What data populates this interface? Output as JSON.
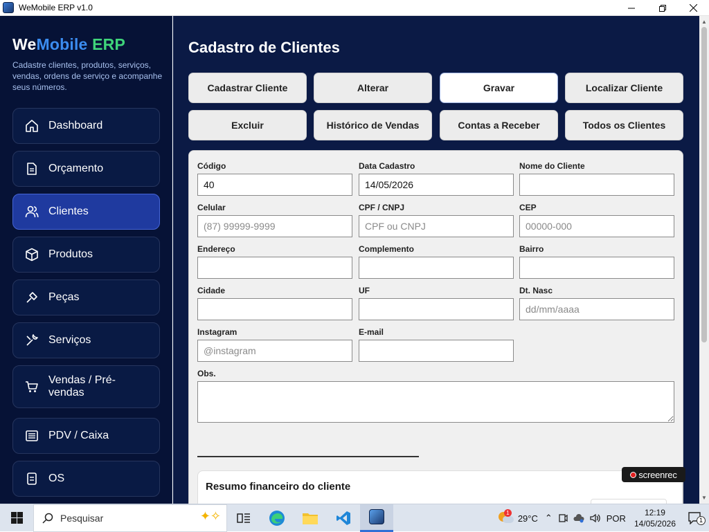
{
  "window": {
    "title": "WeMobile ERP v1.0"
  },
  "brand": {
    "part1": "We",
    "part2": "Mobile",
    "part3": "ERP",
    "description": "Cadastre clientes, produtos, serviços, vendas, ordens de serviço e acompanhe seus números."
  },
  "sidebar": {
    "items": [
      {
        "label": "Dashboard",
        "icon": "home-icon"
      },
      {
        "label": "Orçamento",
        "icon": "document-icon"
      },
      {
        "label": "Clientes",
        "icon": "users-icon",
        "active": true
      },
      {
        "label": "Produtos",
        "icon": "box-icon"
      },
      {
        "label": "Peças",
        "icon": "tool-icon"
      },
      {
        "label": "Serviços",
        "icon": "wrench-icon"
      },
      {
        "label": "Vendas / Pré-vendas",
        "icon": "cart-icon"
      },
      {
        "label": "PDV / Caixa",
        "icon": "register-icon"
      },
      {
        "label": "OS",
        "icon": "clipboard-icon"
      }
    ]
  },
  "main": {
    "title": "Cadastro de Clientes",
    "actions": [
      "Cadastrar Cliente",
      "Alterar",
      "Gravar",
      "Localizar Cliente",
      "Excluir",
      "Histórico de Vendas",
      "Contas a Receber",
      "Todos os Clientes"
    ],
    "fields": {
      "codigo": {
        "label": "Código",
        "value": "40",
        "placeholder": ""
      },
      "data_cadastro": {
        "label": "Data Cadastro",
        "value": "14/05/2026",
        "placeholder": ""
      },
      "nome": {
        "label": "Nome do Cliente",
        "value": "",
        "placeholder": ""
      },
      "celular": {
        "label": "Celular",
        "value": "",
        "placeholder": "(87) 99999-9999"
      },
      "cpf": {
        "label": "CPF / CNPJ",
        "value": "",
        "placeholder": "CPF ou CNPJ"
      },
      "cep": {
        "label": "CEP",
        "value": "",
        "placeholder": "00000-000"
      },
      "endereco": {
        "label": "Endereço",
        "value": "",
        "placeholder": ""
      },
      "complemento": {
        "label": "Complemento",
        "value": "",
        "placeholder": ""
      },
      "bairro": {
        "label": "Bairro",
        "value": "",
        "placeholder": ""
      },
      "cidade": {
        "label": "Cidade",
        "value": "",
        "placeholder": ""
      },
      "uf": {
        "label": "UF",
        "value": "",
        "placeholder": ""
      },
      "dt_nasc": {
        "label": "Dt. Nasc",
        "value": "",
        "placeholder": "dd/mm/aaaa"
      },
      "instagram": {
        "label": "Instagram",
        "value": "",
        "placeholder": "@instagram"
      },
      "email": {
        "label": "E-mail",
        "value": "",
        "placeholder": ""
      },
      "obs": {
        "label": "Obs.",
        "value": ""
      }
    },
    "summary_title": "Resumo financeiro do cliente"
  },
  "watermark": "screenrec",
  "taskbar": {
    "search_text": "Pesquisar",
    "weather": "29°C",
    "weather_badge": "1",
    "language": "POR",
    "time": "12:19",
    "date": "14/05/2026",
    "notifications": "1"
  },
  "colors": {
    "sidebar_bg": "#061236",
    "main_bg": "#0b1a45",
    "accent_blue": "#3b8cf0",
    "accent_green": "#3fd57a",
    "active_nav": "#1f3a9f"
  }
}
